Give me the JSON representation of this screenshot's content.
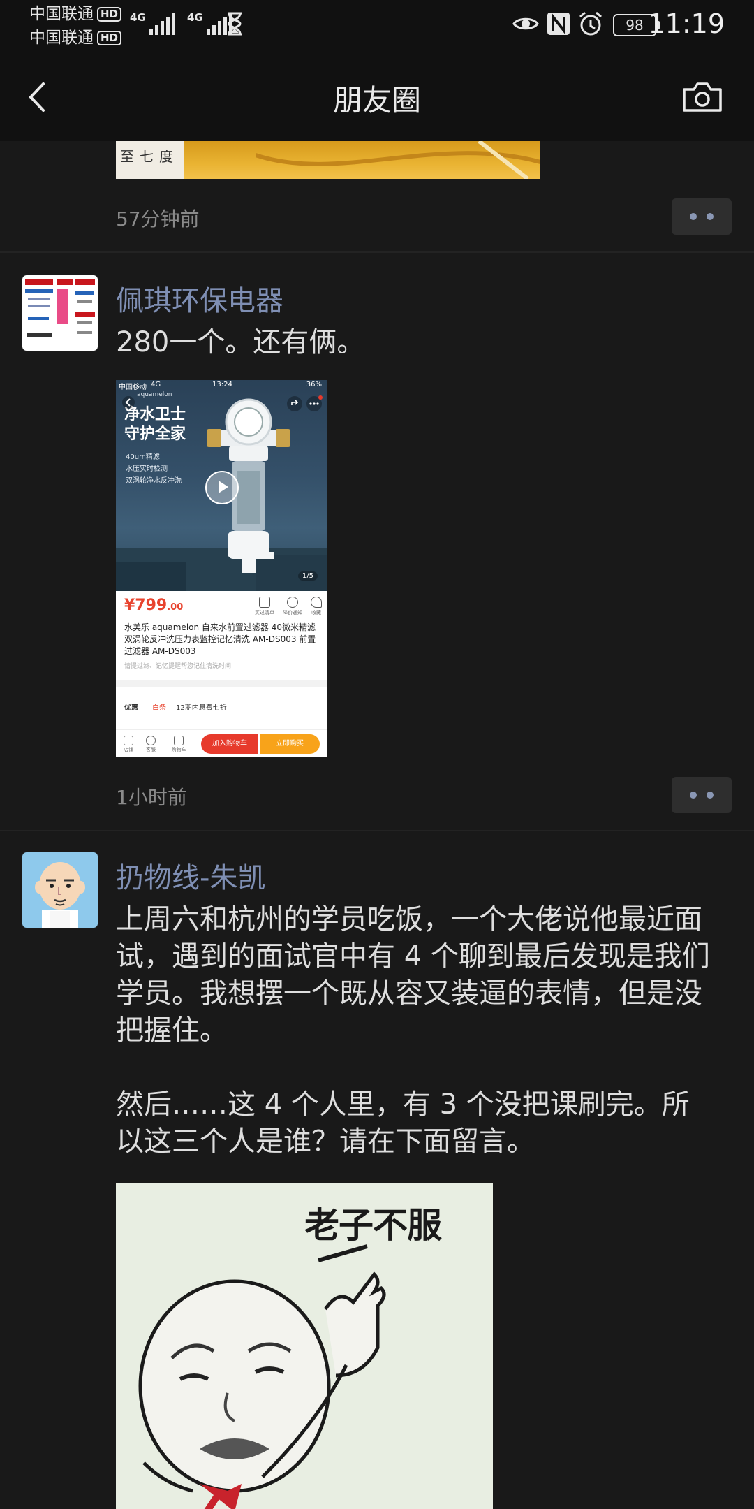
{
  "status_bar": {
    "carrier1": "中国联通",
    "carrier2": "中国联通",
    "hd_badge": "HD",
    "network1": "4G",
    "network2": "4G",
    "battery": "98",
    "time": "11:19",
    "icons": [
      "eye-icon",
      "nfc-icon",
      "alarm-icon",
      "hourglass-icon"
    ]
  },
  "nav": {
    "title": "朋友圈",
    "back_icon": "chevron-left-icon",
    "camera_icon": "camera-icon"
  },
  "prev_post": {
    "image_text": "至七度",
    "timestamp": "57分钟前"
  },
  "posts": [
    {
      "name": "佩琪环保电器",
      "avatar_texts": [
        "Paloma",
        "NORITZ",
        "Rinnai"
      ],
      "text": "280一个。还有俩。",
      "timestamp": "1小时前",
      "shared_image": {
        "status_carrier": "中国移动",
        "status_network": "4G",
        "status_time": "13:24",
        "status_battery": "36%",
        "brand": "aquamelon",
        "headline": "净水卫士\n守护全家",
        "features": "40um精滤\n水压实时检测\n双涡轮净水反冲洗",
        "page_indicator": "1/5",
        "price_main": "¥799",
        "price_decimal": ".00",
        "actions": [
          "买过清单",
          "降价通知",
          "收藏"
        ],
        "title": "水美乐 aquamelon 自来水前置过滤器 40微米精滤双涡轮反冲洗压力表监控记忆清洗 AM-DS003 前置过滤器 AM-DS003",
        "note": "请提过滤、记忆提醒帮您记住清洗时间",
        "promo_label": "优惠",
        "promo_tag": "白条",
        "promo_text": "12期内息费七折",
        "bottom_items": [
          "店铺",
          "客服",
          "购物车"
        ],
        "add_to_cart": "加入购物车",
        "buy_now": "立即购买"
      }
    },
    {
      "name": "扔物线-朱凯",
      "text": "上周六和杭州的学员吃饭，一个大佬说他最近面试，遇到的面试官中有 4 个聊到最后发现是我们学员。我想摆一个既从容又装逼的表情，但是没把握住。\n\n然后……这 4 个人里，有 3 个没把课刷完。所以这三个人是谁？请在下面留言。",
      "meme_caption": "老子不服"
    }
  ]
}
